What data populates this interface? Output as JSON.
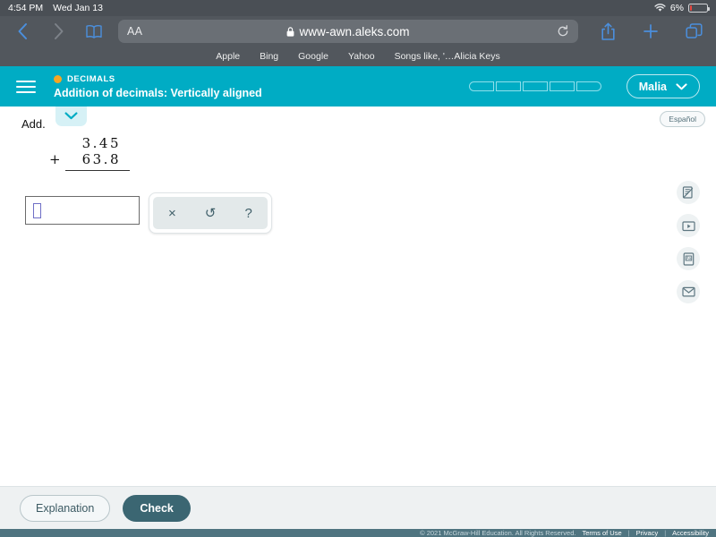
{
  "status_bar": {
    "time": "4:54 PM",
    "date": "Wed Jan 13",
    "wifi_icon": "wifi-icon",
    "battery_percent": "6%",
    "battery_icon": "battery-icon"
  },
  "browser": {
    "back_icon": "chevron-left-icon",
    "forward_icon": "chevron-right-icon",
    "bookmarks_icon": "book-icon",
    "text_size_label": "AA",
    "lock_icon": "lock-icon",
    "url": "www-awn.aleks.com",
    "reload_icon": "reload-icon",
    "share_icon": "share-icon",
    "new_tab_icon": "plus-icon",
    "tabs_icon": "tabs-icon",
    "bookmarks": [
      "Apple",
      "Bing",
      "Google",
      "Yahoo",
      "Songs like, '…Alicia Keys"
    ]
  },
  "app_header": {
    "menu_icon": "hamburger-menu-icon",
    "topic_dot_icon": "status-dot-icon",
    "topic": "DECIMALS",
    "lesson_title": "Addition of decimals: Vertically aligned",
    "progress_segments": 5,
    "user_name": "Malia",
    "user_chevron_icon": "chevron-down-icon",
    "accent_color": "#00acc4",
    "topic_dot_color": "#f5a623"
  },
  "content": {
    "pull_tab_icon": "chevron-down-icon",
    "instruction": "Add.",
    "problem": {
      "addend_1": "3.45",
      "operator": "+",
      "addend_2": "63.8"
    },
    "answer_input": {
      "value": "",
      "caret_icon": "empty-answer-box-icon"
    },
    "math_toolbar": {
      "clear_icon": "×",
      "undo_icon": "↺",
      "help_icon": "?",
      "clear_name": "clear-button",
      "undo_name": "undo-button",
      "help_name": "help-button"
    },
    "espanol_label": "Español",
    "side_tools": [
      {
        "name": "scratchpad-icon",
        "label": "scratchpad"
      },
      {
        "name": "video-icon",
        "label": "video"
      },
      {
        "name": "dictionary-icon",
        "label": "dictionary"
      },
      {
        "name": "message-icon",
        "label": "message"
      }
    ]
  },
  "actions": {
    "explanation_label": "Explanation",
    "check_label": "Check",
    "check_color": "#3b6672"
  },
  "footer": {
    "copyright": "© 2021 McGraw-Hill Education. All Rights Reserved.",
    "links": [
      "Terms of Use",
      "Privacy",
      "Accessibility"
    ],
    "separator": "|"
  }
}
